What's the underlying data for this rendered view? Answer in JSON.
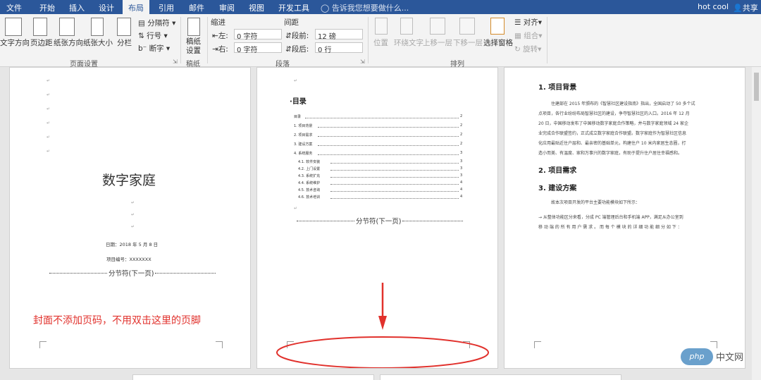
{
  "menu": {
    "tabs": [
      "文件",
      "开始",
      "插入",
      "设计",
      "布局",
      "引用",
      "邮件",
      "审阅",
      "视图",
      "开发工具"
    ],
    "active_tab": "布局",
    "tell_me": "告诉我您想要做什么...",
    "user": "hot cool",
    "share": "共享"
  },
  "ribbon": {
    "page_setup": {
      "text_direction": "文字方向",
      "margins": "页边距",
      "orientation": "纸张方向",
      "size": "纸张大小",
      "columns": "分栏",
      "breaks": "分隔符",
      "line_numbers": "行号",
      "hyphenation": "断字",
      "group_label": "页面设置"
    },
    "manuscript": {
      "button": "稿纸设置",
      "group_label": "稿纸"
    },
    "paragraph": {
      "indent_label": "缩进",
      "spacing_label": "间距",
      "left_label": "左:",
      "left_value": "0 字符",
      "right_label": "右:",
      "right_value": "0 字符",
      "before_label": "段前:",
      "before_value": "12 磅",
      "after_label": "段后:",
      "after_value": "0 行",
      "group_label": "段落"
    },
    "arrange": {
      "position": "位置",
      "wrap_text": "环绕文字",
      "bring_forward": "上移一层",
      "send_backward": "下移一层",
      "selection_pane": "选择窗格",
      "align": "对齐",
      "group": "组合",
      "rotate": "旋转",
      "group_label": "排列"
    }
  },
  "document": {
    "page1": {
      "title": "数字家庭",
      "date": "日期：2018 年 5 月 8 日",
      "project_no": "项目编号：XXXXXXX",
      "section_break": "分节符(下一页)"
    },
    "page2": {
      "toc_heading": "目录",
      "toc": [
        {
          "text": "目录",
          "page": "2"
        },
        {
          "text": "1.  项目背景",
          "page": "2"
        },
        {
          "text": "2.  项目需求",
          "page": "2"
        },
        {
          "text": "3.  建设方案",
          "page": "2"
        },
        {
          "text": "4.  系统服务",
          "page": "3"
        },
        {
          "text": "4.1.  软件安装",
          "page": "3"
        },
        {
          "text": "4.2.  上门设置",
          "page": "3"
        },
        {
          "text": "4.3.  系统扩充",
          "page": "3"
        },
        {
          "text": "4.4.  系统维护",
          "page": "4"
        },
        {
          "text": "4.5.  技术咨询",
          "page": "4"
        },
        {
          "text": "4.6.  技术培训",
          "page": "4"
        }
      ],
      "section_break": "分节符(下一页)"
    },
    "page3": {
      "h1": "1.  项目背景",
      "p1": [
        "住建部在 2015 年颁布的《智慧社区建设指南》指出，全国启动了 50 多个试",
        "点项目，各行业纷纷布局智慧社区的建设，争夺智慧社区的入口。2016 年 12 月",
        "20 日，中国移动发布了中国移动数字家庭合作策略，并与数字家庭领域 24 家企",
        "业完成合作联盟签约，正式成立数字家庭合作联盟。数字家庭作为智慧社区信息",
        "化应用最贴近住户层和、最亲密的基础单元，构建住户 10 米内家居生态圈，打",
        "造小而美、有温度、家和万事兴的数字家庭，有助于提升住户居住幸福感和。"
      ],
      "h2": "2.  项目需求",
      "h3": "3.  建设方案",
      "p3": [
        "故本次项目开发的平台主要功能模块如下所示：",
        "→ 从整体功能区分来看，分成 PC 端管理后台和手机端 APP，满足从办公室到",
        "移 动 端 的 所 有 用 户 需 求 。 而 每 个 模 块 的 详 细 功 能 细 分 如 下 ："
      ]
    },
    "annotation": "封面不添加页码，不用双击这里的页脚",
    "annotation_color": "#e1312c"
  },
  "watermark": {
    "logo": "php",
    "text": "中文网"
  },
  "colors": {
    "ribbon_blue": "#2b579a",
    "annotation_red": "#e1312c"
  }
}
